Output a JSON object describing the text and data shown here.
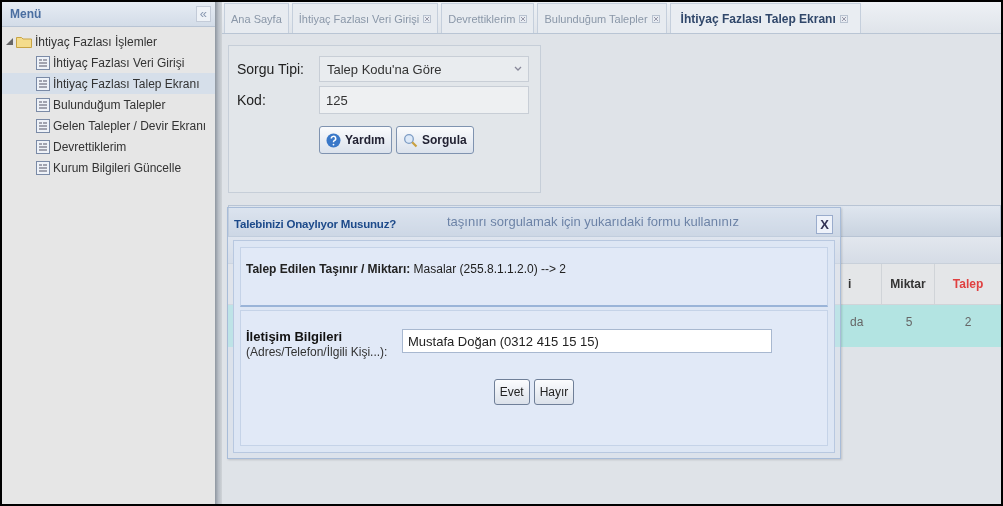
{
  "sidebar": {
    "title": "Menü",
    "collapse": "«",
    "tree": [
      {
        "label": "İhtiyaç Fazlası İşlemler",
        "kind": "folder",
        "expanded": true,
        "selected": false,
        "children": [
          {
            "label": "İhtiyaç Fazlası Veri Girişi",
            "kind": "page",
            "selected": false
          },
          {
            "label": "İhtiyaç Fazlası Talep Ekranı",
            "kind": "page",
            "selected": true
          },
          {
            "label": "Bulunduğum Talepler",
            "kind": "page",
            "selected": false
          },
          {
            "label": "Gelen Talepler / Devir Ekranı",
            "kind": "page",
            "selected": false
          },
          {
            "label": "Devrettiklerim",
            "kind": "page",
            "selected": false
          },
          {
            "label": "Kurum Bilgileri Güncelle",
            "kind": "page",
            "selected": false
          }
        ]
      }
    ]
  },
  "tabs": [
    {
      "label": "Ana Sayfa",
      "closable": false,
      "selected": false
    },
    {
      "label": "İhtiyaç Fazlası Veri Girişi",
      "closable": true,
      "selected": false
    },
    {
      "label": "Devrettiklerim",
      "closable": true,
      "selected": false
    },
    {
      "label": "Bulunduğum Talepler",
      "closable": true,
      "selected": false
    },
    {
      "label": "İhtiyaç Fazlası Talep Ekranı",
      "closable": true,
      "selected": true
    }
  ],
  "query_form": {
    "type_label": "Sorgu Tipi:",
    "type_value": "Talep Kodu'na Göre",
    "code_label": "Kod:",
    "code_value": "125",
    "buttons": [
      {
        "label": "Yardım",
        "kind": "help"
      },
      {
        "label": "Sorgula",
        "kind": "search"
      }
    ]
  },
  "results": {
    "hint": "taşınırı sorgulamak için yukarıdaki formu kullanınız",
    "columns": [
      {
        "label": "i",
        "highlighted": false
      },
      {
        "label": "Miktar",
        "highlighted": false
      },
      {
        "label": "Talep",
        "highlighted": true
      }
    ],
    "rows": [
      {
        "cells": [
          "da",
          "5",
          "2"
        ],
        "selected": true
      }
    ]
  },
  "dialog": {
    "title": "Talebinizi Onaylıyor Musunuz?",
    "close": "X",
    "item_text": "**Talep Edilen Taşınır / Miktarı:** Masalar (255.8.1.1.2.0) --> 2",
    "contact_label": "İletişim Bilgileri",
    "contact_sublabel": "(Adres/Telefon/İlgili Kişi...):",
    "contact_value": "Mustafa Doğan (0312 415 15 15)",
    "buttons": [
      "Evet",
      "Hayır"
    ]
  }
}
